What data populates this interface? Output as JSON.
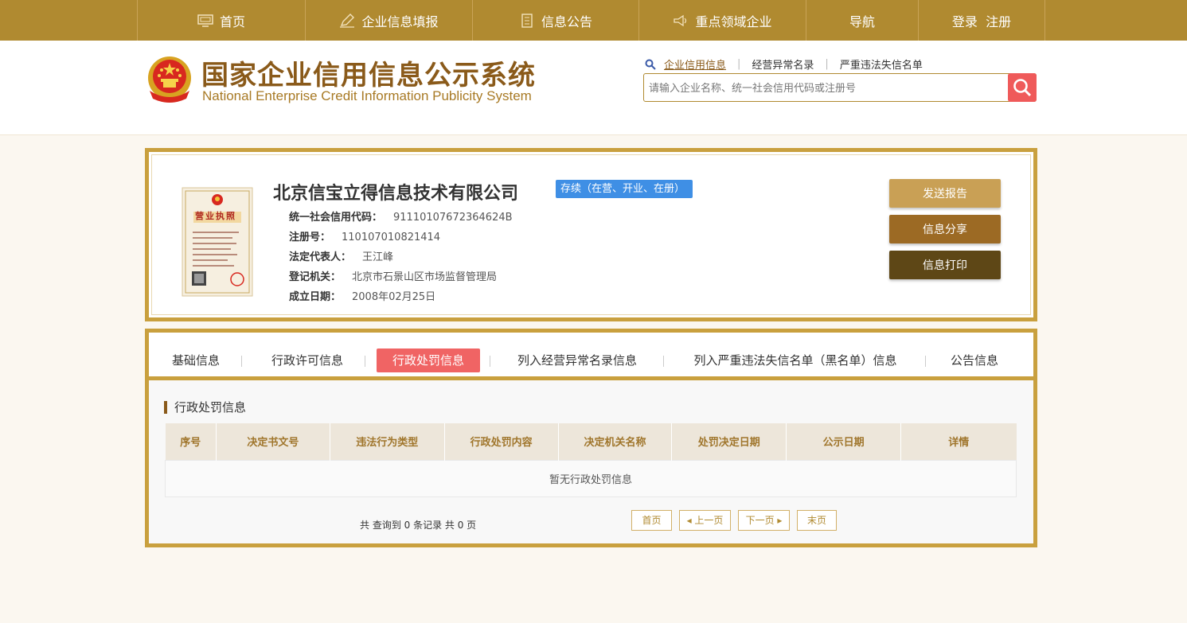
{
  "nav": {
    "items": [
      {
        "label": "首页",
        "icon": "monitor-icon"
      },
      {
        "label": "企业信息填报",
        "icon": "edit-icon"
      },
      {
        "label": "信息公告",
        "icon": "document-icon"
      },
      {
        "label": "重点领域企业",
        "icon": "megaphone-icon"
      },
      {
        "label": "导航",
        "icon": ""
      },
      {
        "label": "登录  注册",
        "icon": ""
      }
    ]
  },
  "header": {
    "title_cn": "国家企业信用信息公示系统",
    "title_en": "National Enterprise Credit Information Publicity System",
    "search_tabs": [
      "企业信用信息",
      "经营异常名录",
      "严重违法失信名单"
    ],
    "search_placeholder": "请输入企业名称、统一社会信用代码或注册号"
  },
  "company": {
    "name": "北京信宝立得信息技术有限公司",
    "status": "存续（在营、开业、在册）",
    "license_caption": "营业执照",
    "fields": [
      {
        "label": "统一社会信用代码：",
        "value": "91110107672364624B"
      },
      {
        "label": "注册号：",
        "value": "110107010821414"
      },
      {
        "label": "法定代表人：",
        "value": "王江峰"
      },
      {
        "label": "登记机关：",
        "value": "北京市石景山区市场监督管理局"
      },
      {
        "label": "成立日期：",
        "value": "2008年02月25日"
      }
    ],
    "buttons": {
      "send": "发送报告",
      "share": "信息分享",
      "print": "信息打印"
    }
  },
  "tabs": {
    "items": [
      "基础信息",
      "行政许可信息",
      "行政处罚信息",
      "列入经营异常名录信息",
      "列入严重违法失信名单（黑名单）信息",
      "公告信息"
    ],
    "active_index": 2
  },
  "section": {
    "title": "行政处罚信息",
    "columns": [
      "序号",
      "决定书文号",
      "违法行为类型",
      "行政处罚内容",
      "决定机关名称",
      "处罚决定日期",
      "公示日期",
      "详情"
    ],
    "empty_text": "暂无行政处罚信息"
  },
  "pager": {
    "info": "共 查询到 0 条记录 共 0 页",
    "first": "首页",
    "prev": "◂ 上一页",
    "next": "下一页 ▸",
    "last": "末页"
  },
  "colors": {
    "brand": "#b08a30",
    "accent_red": "#f06464",
    "status_blue": "#3f8fe5"
  }
}
